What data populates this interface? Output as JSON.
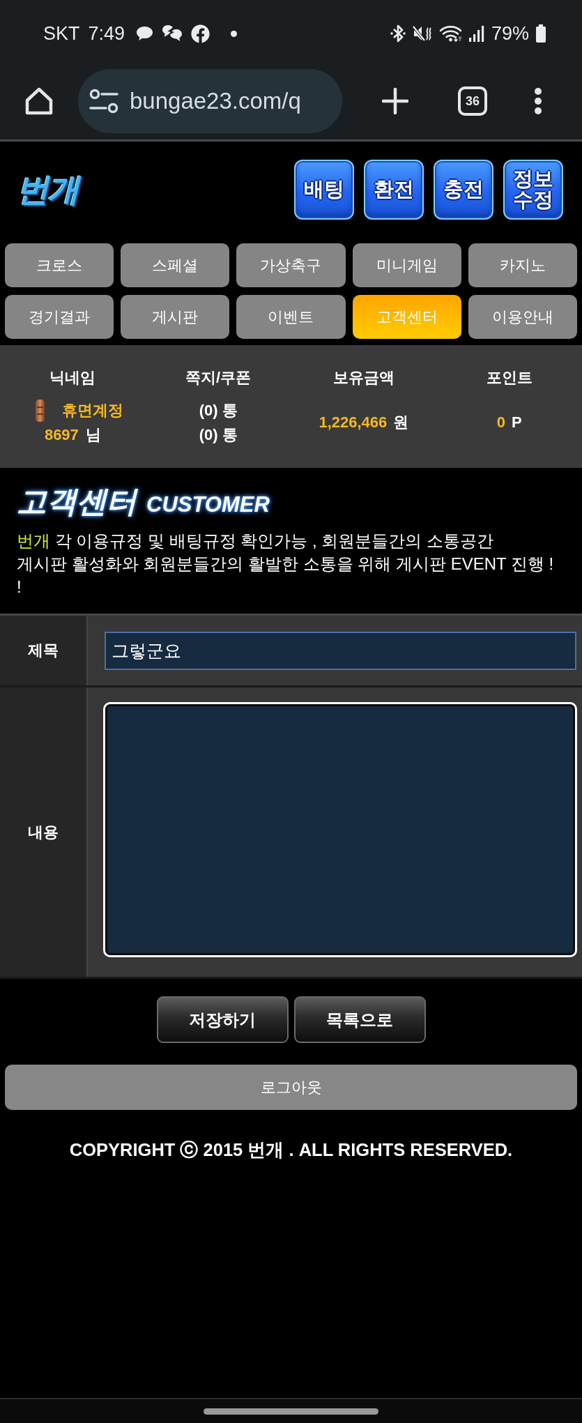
{
  "status_bar": {
    "carrier": "SKT",
    "time": "7:49",
    "battery": "79%"
  },
  "browser": {
    "url": "bungae23.com/q",
    "tab_count": "36"
  },
  "header": {
    "logo": "번개",
    "action_buttons": [
      "배팅",
      "환전",
      "충전",
      "정보 수정"
    ]
  },
  "nav": [
    {
      "label": "크로스",
      "selected": false
    },
    {
      "label": "스페셜",
      "selected": false
    },
    {
      "label": "가상축구",
      "selected": false
    },
    {
      "label": "미니게임",
      "selected": false
    },
    {
      "label": "카지노",
      "selected": false
    },
    {
      "label": "경기결과",
      "selected": false
    },
    {
      "label": "게시판",
      "selected": false
    },
    {
      "label": "이벤트",
      "selected": false
    },
    {
      "label": "고객센터",
      "selected": true
    },
    {
      "label": "이용안내",
      "selected": false
    }
  ],
  "user_info": [
    {
      "kind": "nickname",
      "heading": "닉네임",
      "status": "휴면계정",
      "value": "8697",
      "unit": "님"
    },
    {
      "kind": "counts",
      "heading": "쪽지/쿠폰",
      "lines": [
        "(0) 통",
        "(0) 통"
      ]
    },
    {
      "kind": "amount",
      "heading": "보유금액",
      "value": "1,226,466",
      "unit": "원"
    },
    {
      "kind": "amount",
      "heading": "포인트",
      "value": "0",
      "unit": "P"
    }
  ],
  "section": {
    "title": "고객센터",
    "subtitle": "CUSTOMER",
    "highlight": "번개",
    "lines": [
      "각 이용규정 및 배팅규정 확인가능 , 회원분들간의 소통공간",
      "게시판 활성화와 회원분들간의 활발한 소통을 위해 게시판 EVENT 진행 ! !"
    ]
  },
  "form": {
    "rows": [
      {
        "kind": "input",
        "label": "제목",
        "value": "그렇군요"
      },
      {
        "kind": "textarea",
        "label": "내용"
      }
    ]
  },
  "form_buttons": [
    "저장하기",
    "목록으로"
  ],
  "logout_button": "로그아웃",
  "footer": {
    "copyright": "COPYRIGHT ⓒ 2015 번개 . ALL RIGHTS RESERVED."
  }
}
